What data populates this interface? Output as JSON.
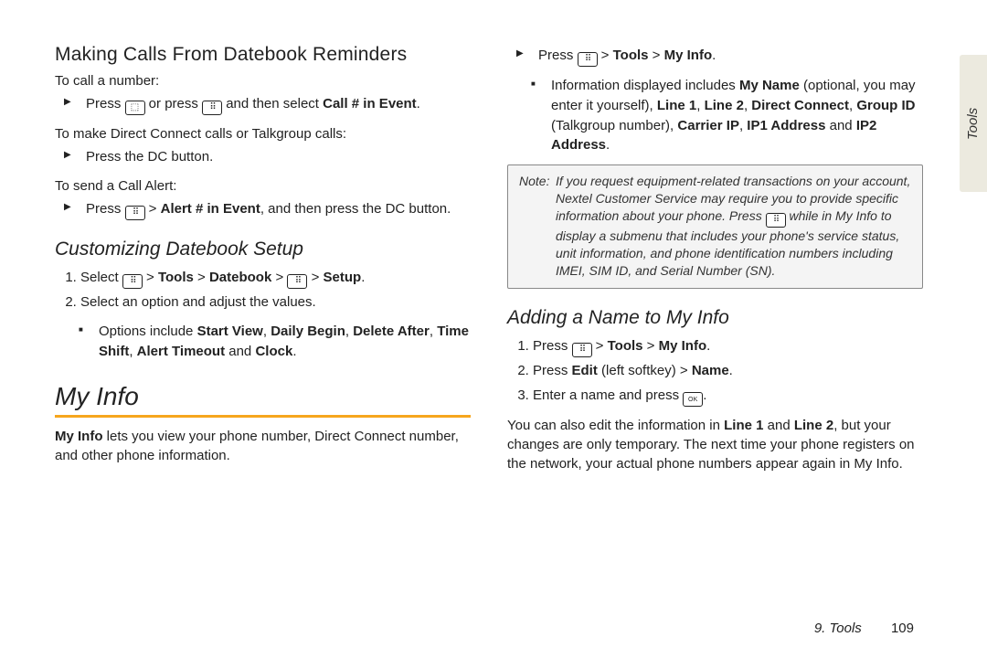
{
  "left": {
    "h_making_calls": "Making Calls From Datebook Reminders",
    "to_call": "To call a number:",
    "call_step_pre": "Press ",
    "call_step_mid": " or press ",
    "call_step_post": " and then select ",
    "call_in_event": "Call # in Event",
    "to_dc": "To make Direct Connect calls or Talkgroup calls:",
    "press_dc": "Press the DC button.",
    "to_alert": "To send a Call Alert:",
    "alert_pre": "Press ",
    "alert_path": "Alert # in Event",
    "alert_post": ", and then press the DC button.",
    "h_customizing": "Customizing Datebook Setup",
    "cust1_pre": "Select ",
    "cust1_path1": "Tools",
    "cust1_path2": "Datebook",
    "cust1_path3": "Setup",
    "cust2": "Select an option and adjust the values.",
    "cust_opts_pre": "Options include ",
    "opt1": "Start View",
    "opt2": "Daily Begin",
    "opt3": "Delete After",
    "opt4": "Time Shift",
    "opt5": "Alert Timeout",
    "opt6": "Clock",
    "h_myinfo": "My Info",
    "myinfo_para_pre": "My Info",
    "myinfo_para_post": " lets you view your phone number, Direct Connect number, and other phone information."
  },
  "right": {
    "top_pre": "Press ",
    "top_path1": "Tools",
    "top_path2": "My Info",
    "info_disp_pre": "Information displayed includes ",
    "mn": "My Name",
    "opt_paren": " (optional, you may enter it yourself), ",
    "l1": "Line 1",
    "l2": "Line 2",
    "dc": "Direct Connect",
    "gid": "Group ID",
    "gid_paren": " (Talkgroup number), ",
    "cip": "Carrier IP",
    "ip1": "IP1 Address",
    "ip2": "IP2 Address",
    "note_label": "Note:",
    "note_body_pre": "If you request equipment-related transactions on your account, Nextel Customer Service may require you to provide specific information about your phone. Press ",
    "note_body_post": " while in My Info to display a submenu that includes your phone's service status, unit information, and phone identification numbers including IMEI, SIM ID, and Serial Number (SN).",
    "h_adding": "Adding a Name to My Info",
    "add1_pre": "Press ",
    "add1_p1": "Tools",
    "add1_p2": "My Info",
    "add2_pre": "Press ",
    "add2_edit": "Edit",
    "add2_soft": " (left softkey) > ",
    "add2_name": "Name",
    "add3_pre": "Enter a name and press ",
    "tail_pre": "You can also edit the information in ",
    "tail_l1": "Line 1",
    "tail_and": " and ",
    "tail_l2": "Line 2",
    "tail_post": ", but your changes are only temporary. The next time your phone registers on the network, your actual phone numbers appear again in My Info."
  },
  "side_tab": "Tools",
  "footer_chapter": "9. Tools",
  "footer_page": "109",
  "sep": " > ",
  "comma": ", ",
  "and_word": " and ",
  "period": "."
}
